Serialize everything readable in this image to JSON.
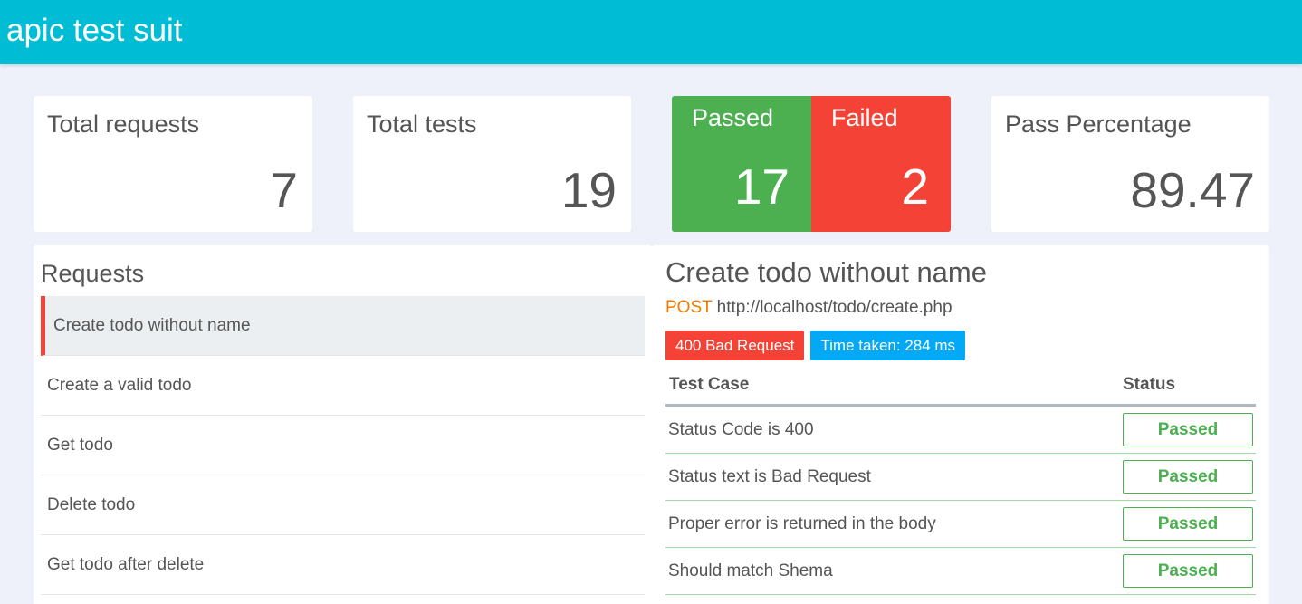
{
  "app": {
    "title": "apic test suit"
  },
  "stats": {
    "total_requests": {
      "label": "Total requests",
      "value": "7"
    },
    "total_tests": {
      "label": "Total tests",
      "value": "19"
    },
    "passed": {
      "label": "Passed",
      "value": "17"
    },
    "failed": {
      "label": "Failed",
      "value": "2"
    },
    "pass_percentage": {
      "label": "Pass Percentage",
      "value": "89.47"
    }
  },
  "requests": {
    "title": "Requests",
    "items": [
      {
        "label": "Create todo without name",
        "active": true
      },
      {
        "label": "Create a valid todo",
        "active": false
      },
      {
        "label": "Get todo",
        "active": false
      },
      {
        "label": "Delete todo",
        "active": false
      },
      {
        "label": "Get todo after delete",
        "active": false
      }
    ]
  },
  "detail": {
    "title": "Create todo without name",
    "method": "POST",
    "url": "http://localhost/todo/create.php",
    "status_badge": "400 Bad Request",
    "time_badge": "Time taken: 284 ms",
    "table": {
      "col_case": "Test Case",
      "col_status": "Status",
      "rows": [
        {
          "name": "Status Code is 400",
          "status": "Passed"
        },
        {
          "name": "Status text is Bad Request",
          "status": "Passed"
        },
        {
          "name": "Proper error is returned in the body",
          "status": "Passed"
        },
        {
          "name": "Should match Shema",
          "status": "Passed"
        }
      ]
    }
  },
  "colors": {
    "topbar": "#00bcd4",
    "passed": "#4caf50",
    "failed": "#f44336",
    "method": "#f57c00",
    "time_badge": "#03a9f4",
    "background": "#eef1fa"
  }
}
